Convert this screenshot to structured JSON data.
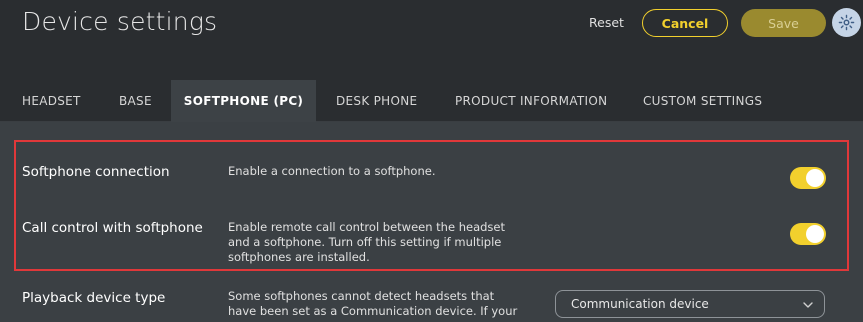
{
  "header": {
    "title": "Device settings",
    "reset_label": "Reset",
    "cancel_label": "Cancel",
    "save_label": "Save",
    "settings_icon": "gear-icon"
  },
  "tabs": [
    {
      "label": "HEADSET",
      "active": false
    },
    {
      "label": "BASE",
      "active": false
    },
    {
      "label": "SOFTPHONE (PC)",
      "active": true
    },
    {
      "label": "DESK PHONE",
      "active": false
    },
    {
      "label": "PRODUCT INFORMATION",
      "active": false
    },
    {
      "label": "CUSTOM SETTINGS",
      "active": false
    }
  ],
  "settings": [
    {
      "label": "Softphone connection",
      "description": "Enable a connection to a softphone.",
      "enabled": true
    },
    {
      "label": "Call control with softphone",
      "description_lines": [
        "Enable remote call control between the headset",
        "and a softphone. Turn off this setting if multiple",
        "softphones are installed."
      ],
      "enabled": true
    },
    {
      "label": "Playback device type",
      "description_lines": [
        "Some softphones cannot detect headsets that",
        "have been set as a Communication device. If your"
      ],
      "selected_value": "Communication device"
    }
  ],
  "colors": {
    "accent": "#f2d02d",
    "highlight_border": "#e0383a",
    "header_bg": "#2a2d30",
    "content_bg": "#3b4044"
  }
}
